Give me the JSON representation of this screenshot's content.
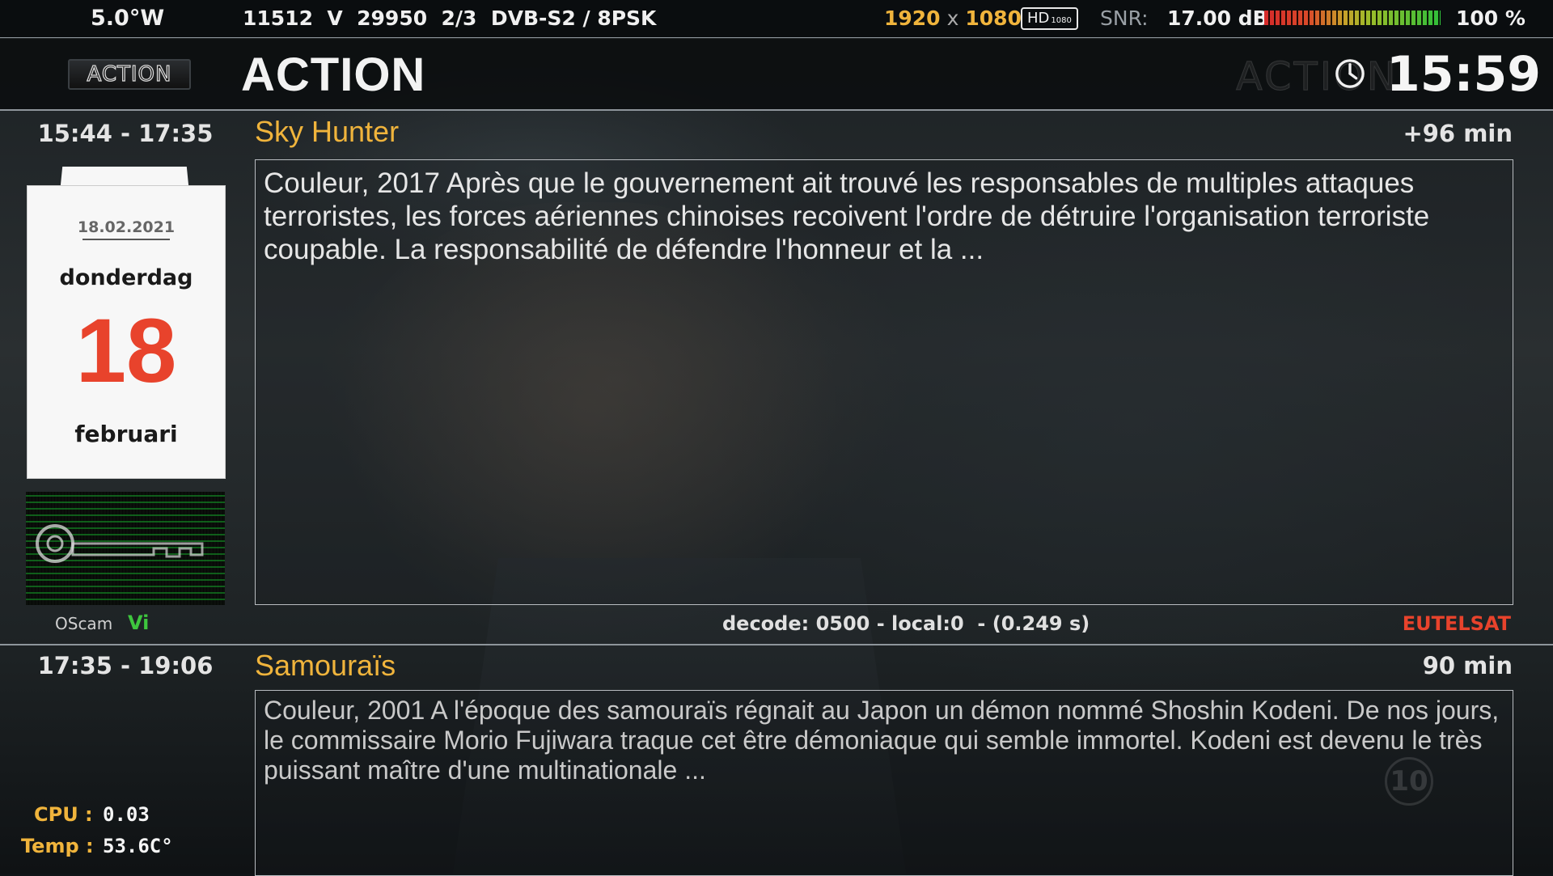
{
  "status_bar": {
    "orbital_position": "5.0°W",
    "transponder": "11512  V  29950  2/3  DVB-S2 / 8PSK",
    "resolution_width": "1920",
    "resolution_x": "x",
    "resolution_height": "1080",
    "hd_badge": "HD",
    "hd_badge_sub": "1080",
    "snr_label": "SNR:",
    "snr_value": "17.00 dB",
    "signal_percent": "100 %",
    "signal_level": 1.0
  },
  "header": {
    "logo_text": "ACTION",
    "channel_name": "ACTION",
    "watermark_text": "ACTION",
    "clock": "15:59"
  },
  "calendar": {
    "date": "18.02.2021",
    "weekday": "donderdag",
    "day": "18",
    "month": "februari"
  },
  "oscam": {
    "label": "OScam",
    "value": "Vi"
  },
  "current_event": {
    "time_range": "15:44 - 17:35",
    "title": "Sky Hunter",
    "remaining": "+96 min",
    "description": "Couleur, 2017  Après que le gouvernement ait trouvé les responsables de multiples attaques terroristes, les forces aériennes chinoises recoivent l'ordre de détruire l'organisation terroriste coupable. La responsabilité de défendre l'honneur et la ..."
  },
  "decode_info": "decode: 0500 - local:0  - (0.249 s)",
  "provider": "EUTELSAT",
  "next_event": {
    "time_range": "17:35 - 19:06",
    "title": "Samouraïs",
    "duration": "90 min",
    "description": "Couleur, 2001  A l'époque des samouraïs régnait au Japon un démon nommé Shoshin Kodeni. De nos jours, le commissaire Morio Fujiwara traque cet être démoniaque qui semble immortel. Kodeni est devenu le très puissant maître d'une multinationale ..."
  },
  "system": {
    "cpu_label": "CPU :",
    "cpu_value": "0.03",
    "temp_label": "Temp :",
    "temp_value": "53.6C°"
  },
  "channel_watermark": "10",
  "colors": {
    "accent_orange": "#f0b43c",
    "calendar_red": "#e8432c",
    "oscam_green": "#3ec63e",
    "provider_red": "#e8432c"
  },
  "icons": [
    "clock-icon",
    "key-icon"
  ]
}
